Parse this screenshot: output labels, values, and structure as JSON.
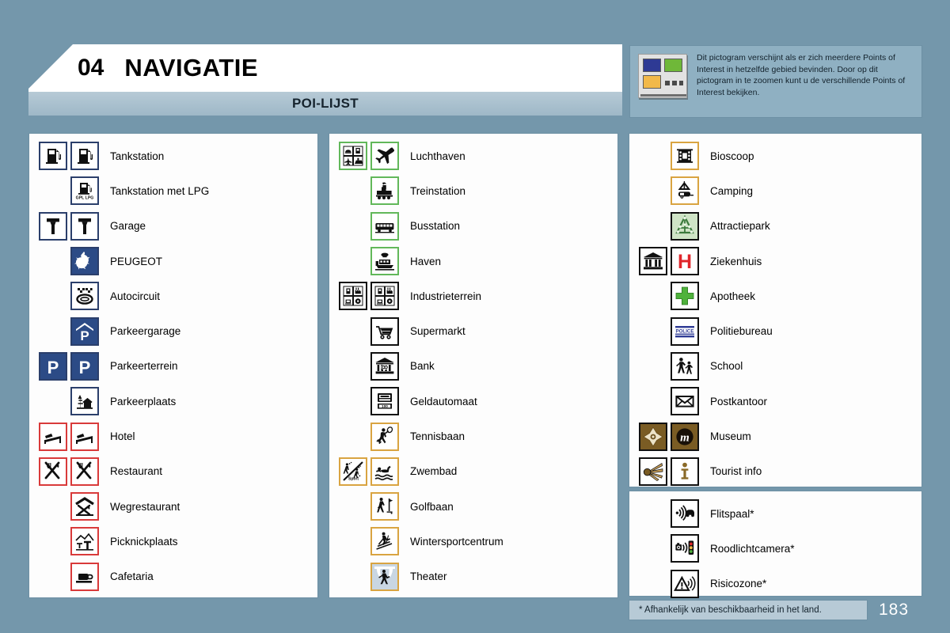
{
  "page": {
    "chapter_number": "04",
    "chapter_title": "NAVIGATIE",
    "section_title": "POI-LIJST",
    "page_number": "183",
    "footnote": "* Afhankelijk van beschikbaarheid in het land.",
    "background_color": "#7497ab",
    "panel_border_color": "#6d90a4"
  },
  "info_box": {
    "icon_name": "multi-poi-icon",
    "text": "Dit pictogram verschijnt als er zich meerdere Points of Interest in hetzelfde gebied bevinden. Door op dit pictogram in te zoomen kunt u de verschillende Points of Interest bekijken.",
    "colors": {
      "blue": "#2e3a94",
      "green": "#6fb839",
      "orange": "#f2b949"
    }
  },
  "columns": [
    {
      "id": "left",
      "items": [
        {
          "label": "Tankstation",
          "icons": [
            "fuel-pump-white",
            "fuel-pump-white"
          ]
        },
        {
          "label": "Tankstation met LPG",
          "icons": [
            "fuel-pump-lpg"
          ]
        },
        {
          "label": "Garage",
          "icons": [
            "wrench-white",
            "wrench-white"
          ]
        },
        {
          "label": "PEUGEOT",
          "icons": [
            "peugeot-lion"
          ]
        },
        {
          "label": "Autocircuit",
          "icons": [
            "race-track"
          ]
        },
        {
          "label": "Parkeergarage",
          "icons": [
            "parking-garage"
          ]
        },
        {
          "label": "Parkeerterrein",
          "icons": [
            "parking-lot",
            "parking-lot"
          ]
        },
        {
          "label": "Parkeerplaats",
          "icons": [
            "rest-area"
          ]
        },
        {
          "label": "Hotel",
          "icons": [
            "bed",
            "bed"
          ]
        },
        {
          "label": "Restaurant",
          "icons": [
            "cutlery",
            "cutlery"
          ]
        },
        {
          "label": "Wegrestaurant",
          "icons": [
            "roadside-restaurant"
          ]
        },
        {
          "label": "Picknickplaats",
          "icons": [
            "picnic-table"
          ]
        },
        {
          "label": "Cafetaria",
          "icons": [
            "coffee-cup"
          ]
        }
      ]
    },
    {
      "id": "middle",
      "items": [
        {
          "label": "Luchthaven",
          "icons": [
            "multi-transport",
            "airplane"
          ]
        },
        {
          "label": "Treinstation",
          "icons": [
            "locomotive"
          ]
        },
        {
          "label": "Busstation",
          "icons": [
            "bus"
          ]
        },
        {
          "label": "Haven",
          "icons": [
            "ship"
          ]
        },
        {
          "label": "Industrieterrein",
          "icons": [
            "industry-grid",
            "industry-grid"
          ]
        },
        {
          "label": "Supermarkt",
          "icons": [
            "shopping-cart"
          ]
        },
        {
          "label": "Bank",
          "icons": [
            "bank-building"
          ]
        },
        {
          "label": "Geldautomaat",
          "icons": [
            "atm"
          ]
        },
        {
          "label": "Tennisbaan",
          "icons": [
            "tennis-player"
          ]
        },
        {
          "label": "Zwembad",
          "icons": [
            "multi-sport",
            "swimmer"
          ]
        },
        {
          "label": "Golfbaan",
          "icons": [
            "golf-player"
          ]
        },
        {
          "label": "Wintersportcentrum",
          "icons": [
            "skier"
          ]
        },
        {
          "label": "Theater",
          "icons": [
            "theater-stage"
          ]
        }
      ]
    },
    {
      "id": "right",
      "items": [
        {
          "label": "Bioscoop",
          "icons": [
            "film-reel"
          ]
        },
        {
          "label": "Camping",
          "icons": [
            "tent-caravan"
          ]
        },
        {
          "label": "Attractiepark",
          "icons": [
            "amusement-park"
          ]
        },
        {
          "label": "Ziekenhuis",
          "icons": [
            "classical-building",
            "hospital-h"
          ]
        },
        {
          "label": "Apotheek",
          "icons": [
            "green-cross"
          ]
        },
        {
          "label": "Politiebureau",
          "icons": [
            "police-sign"
          ]
        },
        {
          "label": "School",
          "icons": [
            "school-children"
          ]
        },
        {
          "label": "Postkantoor",
          "icons": [
            "envelope"
          ]
        },
        {
          "label": "Museum",
          "icons": [
            "museum-ornament",
            "museum-m"
          ]
        },
        {
          "label": "Tourist info",
          "icons": [
            "info-rays",
            "info-i"
          ]
        }
      ]
    },
    {
      "id": "right-lower",
      "items": [
        {
          "label": "Flitspaal*",
          "icons": [
            "speed-camera"
          ]
        },
        {
          "label": "Roodlichtcamera*",
          "icons": [
            "red-light-camera"
          ]
        },
        {
          "label": "Risicozone*",
          "icons": [
            "risk-zone"
          ]
        }
      ]
    }
  ]
}
